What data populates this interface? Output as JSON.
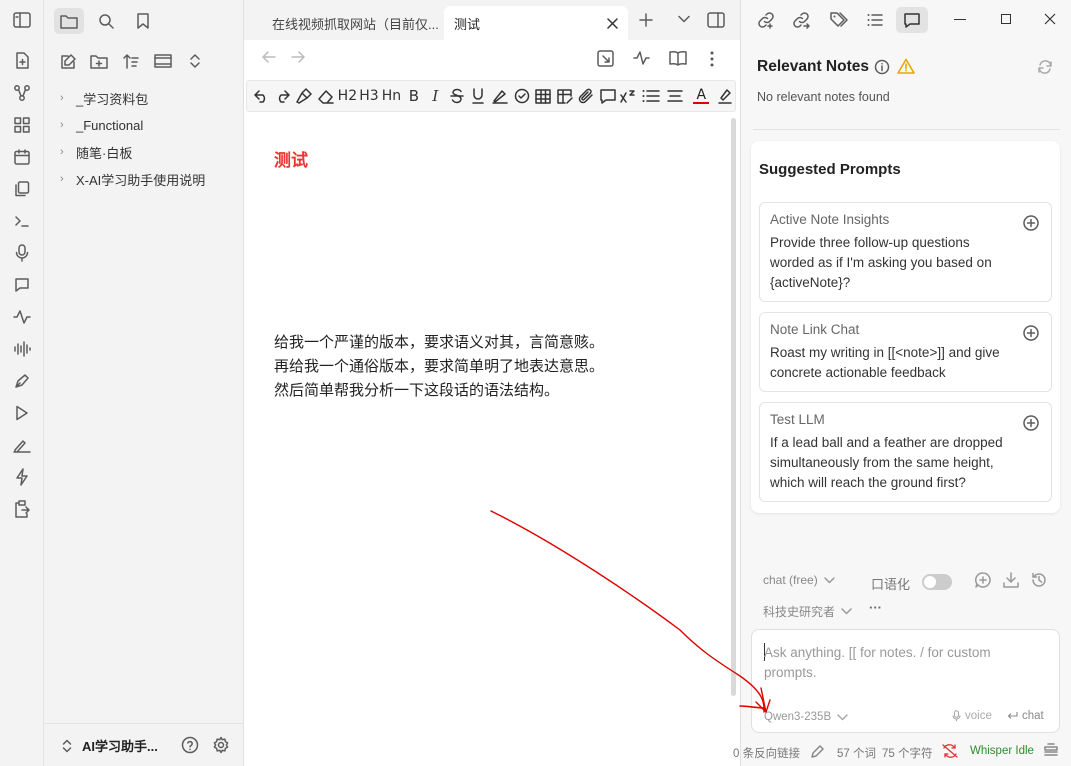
{
  "tabs": [
    {
      "label": "在线视频抓取网站（目前仅..."
    },
    {
      "label": "测试"
    }
  ],
  "sidebar": {
    "items": [
      {
        "label": "_学习资料包"
      },
      {
        "label": "_Functional"
      },
      {
        "label": "随笔·白板"
      },
      {
        "label": "X-AI学习助手使用说明"
      }
    ],
    "vault_name": "AI学习助手..."
  },
  "format_toolbar": {
    "h2": "H2",
    "h3": "H3",
    "hn": "Hn",
    "bold": "B",
    "italic": "I",
    "font_color_letter": "A"
  },
  "note": {
    "title": "测试",
    "lines": [
      "给我一个严谨的版本，要求语义对其，言简意赅。",
      "再给我一个通俗版本，要求简单明了地表达意思。",
      "然后简单帮我分析一下这段话的语法结构。"
    ]
  },
  "relevant_notes": {
    "title": "Relevant Notes",
    "empty_text": "No relevant notes found"
  },
  "suggested_prompts": {
    "title": "Suggested Prompts",
    "cards": [
      {
        "title": "Active Note Insights",
        "body": "Provide three follow-up questions worded as if I'm asking you based on {activeNote}?"
      },
      {
        "title": "Note Link Chat",
        "body": "Roast my writing in [[<note>]] and give concrete actionable feedback"
      },
      {
        "title": "Test LLM",
        "body": "If a lead ball and a feather are dropped simultaneously from the same height, which will reach the ground first?"
      }
    ]
  },
  "chat": {
    "mode": "chat (free)",
    "colloquial_label": "口语化",
    "persona": "科技史研究者",
    "more": "···",
    "input_placeholder": "Ask anything. [[ for notes. / for custom prompts.",
    "model": "Qwen3-235B",
    "voice_label": "voice",
    "chat_label": "chat"
  },
  "status_bar": {
    "backlinks": "0 条反向链接",
    "words": "57 个词",
    "chars": "75 个字符",
    "whisper": "Whisper Idle"
  },
  "colors": {
    "title_red": "#e33333",
    "warning": "#e6a700",
    "whisper_green": "#2e8b2e",
    "annotation_red": "#e00000"
  }
}
